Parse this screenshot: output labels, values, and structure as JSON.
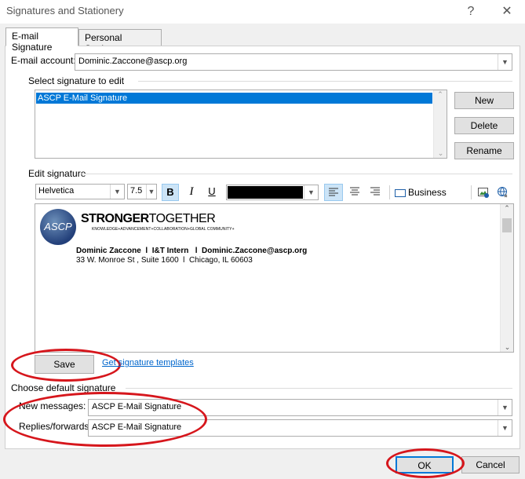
{
  "window": {
    "title": "Signatures and Stationery",
    "help": "?",
    "close": "✕"
  },
  "tabs": [
    {
      "label": "E-mail Signature"
    },
    {
      "label": "Personal Stationery"
    }
  ],
  "account": {
    "label": "E-mail account:",
    "value": "Dominic.Zaccone@ascp.org"
  },
  "select_sig": {
    "label": "Select signature to edit",
    "items": [
      "ASCP E-Mail Signature"
    ]
  },
  "buttons": {
    "new": "New",
    "delete": "Delete",
    "rename": "Rename",
    "save": "Save",
    "ok": "OK",
    "cancel": "Cancel"
  },
  "edit": {
    "label": "Edit signature",
    "font": "Helvetica",
    "size": "7.5",
    "bold": "B",
    "italic": "I",
    "underline": "U",
    "business_card": "Business Card"
  },
  "signature": {
    "logo_text": "ASCP",
    "tagline_bold": "STRONGER",
    "tagline_light": "TOGETHER",
    "subtagline": "KNOWLEDGE+ADVANCEMENT+COLLABORATION+GLOBAL COMMUNITY+",
    "line1": "Dominic Zaccone  l  I&T Intern   l  Dominic.Zaccone@ascp.org",
    "line2": "33 W. Monroe St , Suite 1600  l  Chicago, IL 60603"
  },
  "templates_link": "Get signature templates",
  "defaults": {
    "label": "Choose default signature",
    "new_label": "New messages:",
    "new_value": "ASCP E-Mail Signature",
    "reply_label": "Replies/forwards:",
    "reply_value": "ASCP E-Mail Signature"
  },
  "colors": {
    "selection": "#0078d7",
    "annotation": "#d6161c",
    "link": "#0066cc"
  }
}
